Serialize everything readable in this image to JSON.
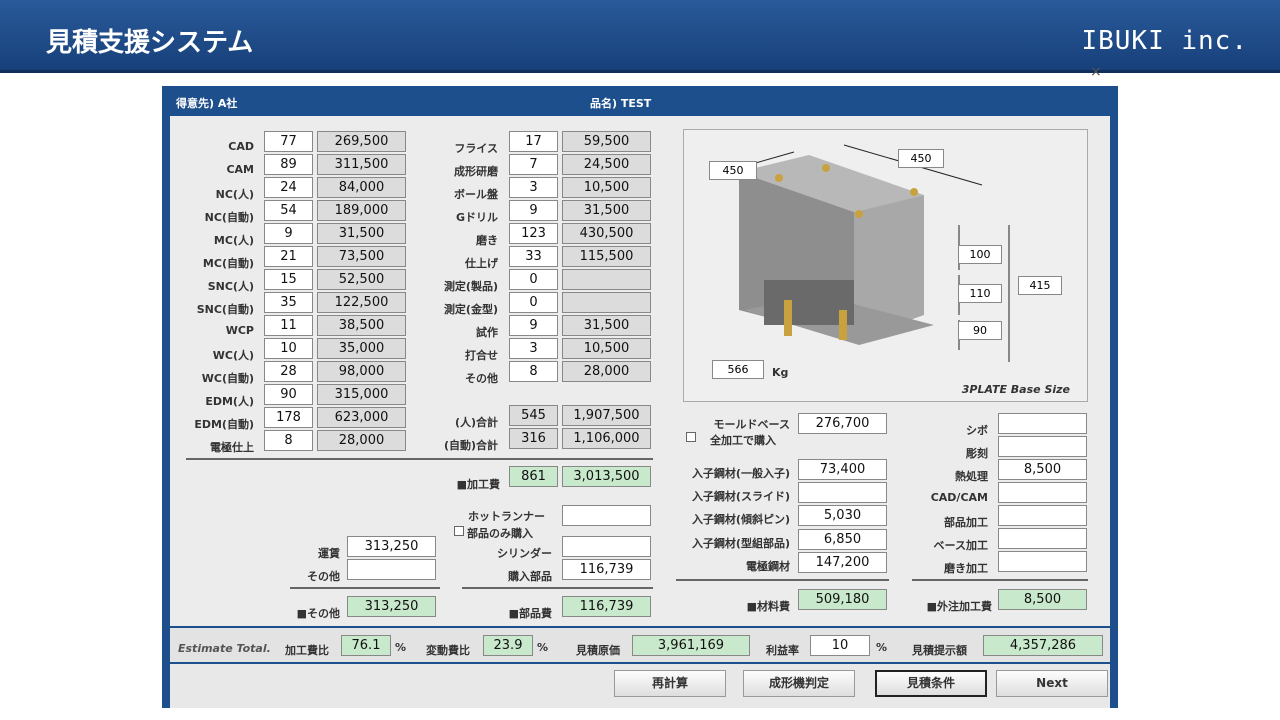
{
  "header": {
    "title": "見積支援システム",
    "company": "IBUKI inc."
  },
  "window": {
    "customer": "得意先) A社",
    "product": "品名) TEST"
  },
  "left_rows": [
    {
      "label": "CAD",
      "qty": "77",
      "amount": "269,500"
    },
    {
      "label": "CAM",
      "qty": "89",
      "amount": "311,500"
    },
    {
      "label": "NC(人)",
      "qty": "24",
      "amount": "84,000"
    },
    {
      "label": "NC(自動)",
      "qty": "54",
      "amount": "189,000"
    },
    {
      "label": "MC(人)",
      "qty": "9",
      "amount": "31,500"
    },
    {
      "label": "MC(自動)",
      "qty": "21",
      "amount": "73,500"
    },
    {
      "label": "SNC(人)",
      "qty": "15",
      "amount": "52,500"
    },
    {
      "label": "SNC(自動)",
      "qty": "35",
      "amount": "122,500"
    },
    {
      "label": "WCP",
      "qty": "11",
      "amount": "38,500"
    },
    {
      "label": "WC(人)",
      "qty": "10",
      "amount": "35,000"
    },
    {
      "label": "WC(自動)",
      "qty": "28",
      "amount": "98,000"
    },
    {
      "label": "EDM(人)",
      "qty": "90",
      "amount": "315,000"
    },
    {
      "label": "EDM(自動)",
      "qty": "178",
      "amount": "623,000"
    },
    {
      "label": "電極仕上",
      "qty": "8",
      "amount": "28,000"
    }
  ],
  "mid_rows": [
    {
      "label": "フライス",
      "qty": "17",
      "amount": "59,500"
    },
    {
      "label": "成形研磨",
      "qty": "7",
      "amount": "24,500"
    },
    {
      "label": "ボール盤",
      "qty": "3",
      "amount": "10,500"
    },
    {
      "label": "Gドリル",
      "qty": "9",
      "amount": "31,500"
    },
    {
      "label": "磨き",
      "qty": "123",
      "amount": "430,500"
    },
    {
      "label": "仕上げ",
      "qty": "33",
      "amount": "115,500"
    },
    {
      "label": "測定(製品)",
      "qty": "0",
      "amount": ""
    },
    {
      "label": "測定(金型)",
      "qty": "0",
      "amount": ""
    },
    {
      "label": "試作",
      "qty": "9",
      "amount": "31,500"
    },
    {
      "label": "打合せ",
      "qty": "3",
      "amount": "10,500"
    },
    {
      "label": "その他",
      "qty": "8",
      "amount": "28,000"
    }
  ],
  "mid_totals": [
    {
      "label": "(人)合計",
      "qty": "545",
      "amount": "1,907,500"
    },
    {
      "label": "(自動)合計",
      "qty": "316",
      "amount": "1,106,000"
    }
  ],
  "processing": {
    "label": "■加工費",
    "qty": "861",
    "amount": "3,013,500"
  },
  "other": {
    "freight_label": "運賃",
    "freight": "313,250",
    "other_label": "その他",
    "other_value": "",
    "total_label": "■その他",
    "total": "313,250"
  },
  "parts": {
    "hotrunner_label": "ホットランナー",
    "parts_only_label": "部品のみ購入",
    "cylinder_label": "シリンダー",
    "purchase_label": "購入部品",
    "purchase": "116,739",
    "total_label": "■部品費",
    "total": "116,739",
    "hotrunner": "",
    "cylinder": ""
  },
  "image": {
    "caption": "3PLATE Base Size",
    "w1": "450",
    "w2": "450",
    "h1": "100",
    "h2": "110",
    "h3": "90",
    "htotal": "415",
    "weight": "566",
    "unit": "Kg"
  },
  "material": {
    "moldbase_label": "モールドベース",
    "moldbase": "276,700",
    "fullmachining_label": "全加工で購入",
    "rows": [
      {
        "label": "入子鋼材(一般入子)",
        "value": "73,400"
      },
      {
        "label": "入子鋼材(スライド)",
        "value": ""
      },
      {
        "label": "入子鋼材(傾斜ピン)",
        "value": "5,030"
      },
      {
        "label": "入子鋼材(型組部品)",
        "value": "6,850"
      },
      {
        "label": "電極鋼材",
        "value": "147,200"
      }
    ],
    "total_label": "■材料費",
    "total": "509,180"
  },
  "outsource": {
    "rows": [
      {
        "label": "シボ",
        "value": ""
      },
      {
        "label": "彫刻",
        "value": ""
      },
      {
        "label": "熱処理",
        "value": "8,500"
      },
      {
        "label": "CAD/CAM",
        "value": ""
      },
      {
        "label": "部品加工",
        "value": ""
      },
      {
        "label": "ベース加工",
        "value": ""
      },
      {
        "label": "磨き加工",
        "value": ""
      }
    ],
    "total_label": "■外注加工費",
    "total": "8,500"
  },
  "totals": {
    "estimate_label": "Estimate Total.",
    "proc_ratio_label": "加工費比",
    "proc_ratio": "76.1",
    "var_ratio_label": "変動費比",
    "var_ratio": "23.9",
    "pct": "%",
    "cost_label": "見積原価",
    "cost": "3,961,169",
    "margin_label": "利益率",
    "margin": "10",
    "quote_label": "見積提示額",
    "quote": "4,357,286"
  },
  "buttons": {
    "recalc": "再計算",
    "machine": "成形機判定",
    "conditions": "見積条件",
    "next": "Next"
  }
}
